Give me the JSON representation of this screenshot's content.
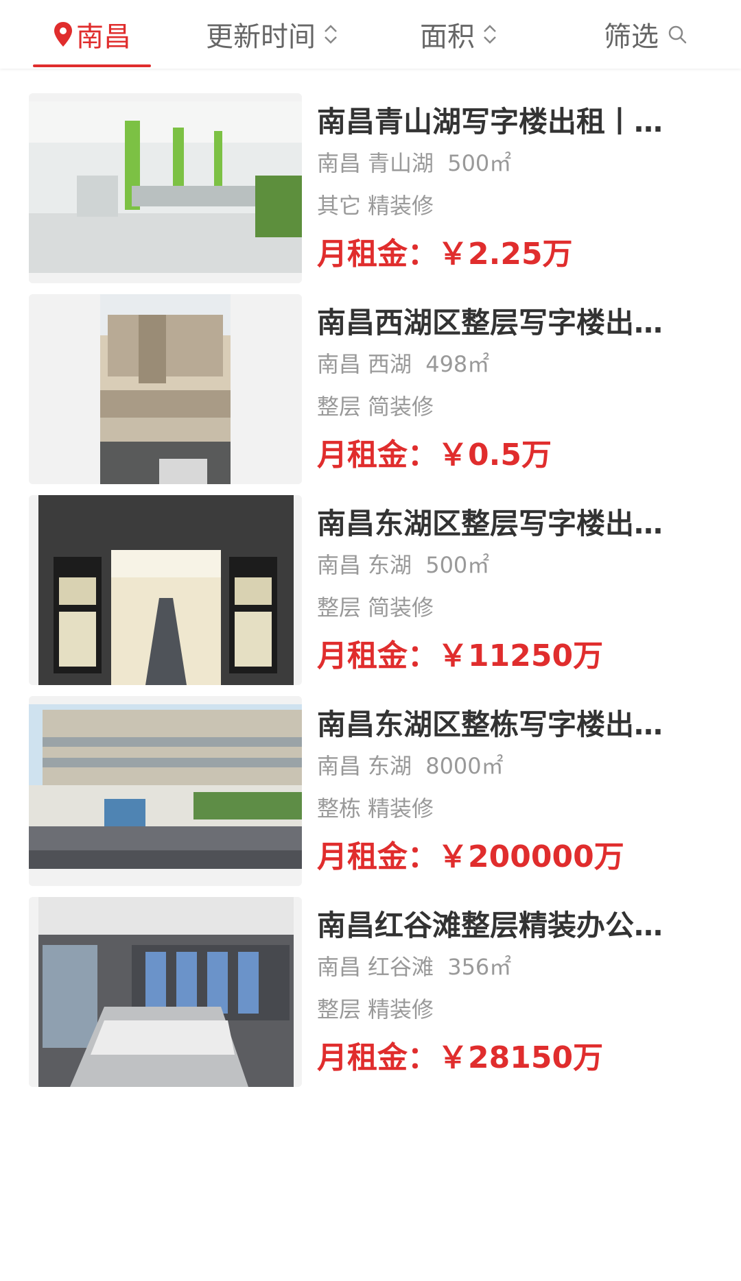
{
  "tabs": {
    "city": "南昌",
    "update_time": "更新时间",
    "area": "面积",
    "filter": "筛选"
  },
  "colors": {
    "accent": "#e02d2d",
    "title": "#333333",
    "meta": "#999999"
  },
  "listings": [
    {
      "title": "南昌青山湖写字楼出租丨…",
      "city": "南昌",
      "district": "青山湖",
      "area": "500㎡",
      "type": "其它",
      "decoration": "精装修",
      "price_label": "月租金：",
      "price": "￥2.25万",
      "image": "open-office-photo"
    },
    {
      "title": "南昌西湖区整层写字楼出…",
      "city": "南昌",
      "district": "西湖",
      "area": "498㎡",
      "type": "整层",
      "decoration": "简装修",
      "price_label": "月租金：",
      "price": "￥0.5万",
      "image": "building-facade-photo"
    },
    {
      "title": "南昌东湖区整层写字楼出…",
      "city": "南昌",
      "district": "东湖",
      "area": "500㎡",
      "type": "整层",
      "decoration": "简装修",
      "price_label": "月租金：",
      "price": "￥11250万",
      "image": "empty-room-photo"
    },
    {
      "title": "南昌东湖区整栋写字楼出…",
      "city": "南昌",
      "district": "东湖",
      "area": "8000㎡",
      "type": "整栋",
      "decoration": "精装修",
      "price_label": "月租金：",
      "price": "￥200000万",
      "image": "office-building-photo"
    },
    {
      "title": "南昌红谷滩整层精装办公…",
      "city": "南昌",
      "district": "红谷滩",
      "area": "356㎡",
      "type": "整层",
      "decoration": "精装修",
      "price_label": "月租金：",
      "price": "￥28150万",
      "image": "meeting-room-photo"
    }
  ]
}
